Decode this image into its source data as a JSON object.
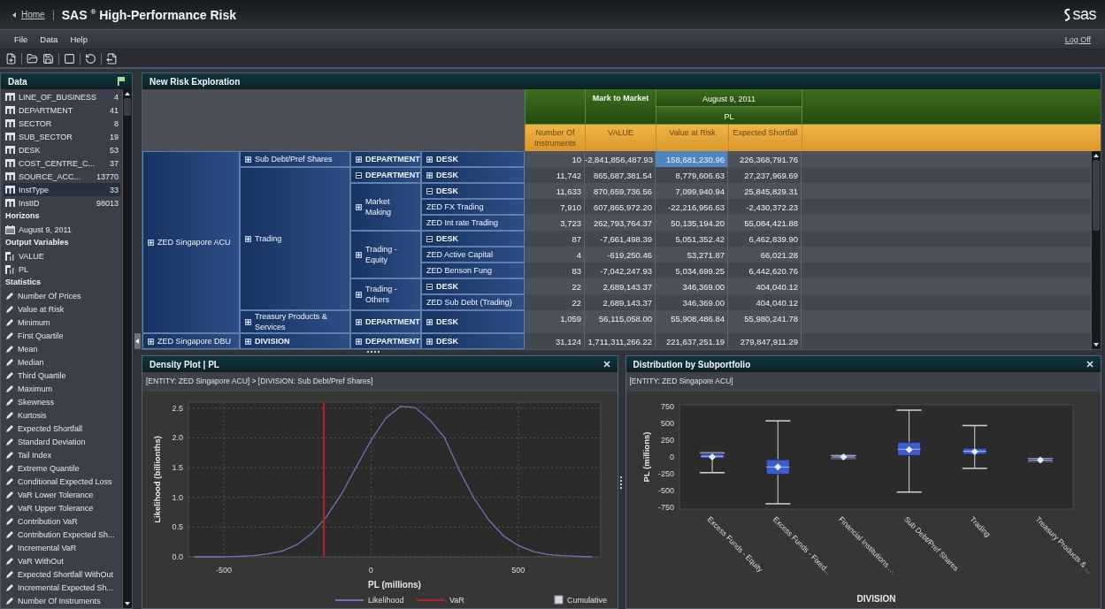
{
  "header": {
    "home_link": "Home",
    "app_title": "SAS $^{®}$ High-Performance Risk",
    "logo_text": "sas"
  },
  "menu": {
    "items": [
      "File",
      "Data",
      "Help"
    ],
    "log_off": "Log Off"
  },
  "data_panel": {
    "title": "Data",
    "groups": [
      {
        "items": [
          {
            "label": "LINE_OF_BUSINESS",
            "count": "4",
            "kind": "dimension",
            "selected": false
          },
          {
            "label": "DEPARTMENT",
            "count": "41",
            "kind": "dimension",
            "selected": false
          },
          {
            "label": "SECTOR",
            "count": "8",
            "kind": "dimension",
            "selected": false
          },
          {
            "label": "SUB_SECTOR",
            "count": "19",
            "kind": "dimension",
            "selected": false
          },
          {
            "label": "DESK",
            "count": "53",
            "kind": "dimension",
            "selected": false
          },
          {
            "label": "COST_CENTRE_C...",
            "count": "37",
            "kind": "dimension",
            "selected": false
          },
          {
            "label": "SOURCE_ACC...",
            "count": "13770",
            "kind": "dimension",
            "selected": false
          },
          {
            "label": "InstType",
            "count": "33",
            "kind": "dimension",
            "selected": true
          },
          {
            "label": "InstID",
            "count": "98013",
            "kind": "dimension",
            "selected": false
          }
        ]
      },
      {
        "heading": "Horizons",
        "items": [
          {
            "label": "August 9, 2011",
            "kind": "date",
            "selected": false
          }
        ]
      },
      {
        "heading": "Output Variables",
        "items": [
          {
            "label": "VALUE",
            "kind": "variable",
            "selected": false
          },
          {
            "label": "PL",
            "kind": "variable",
            "selected": false
          }
        ]
      },
      {
        "heading": "Statistics",
        "items": [
          {
            "label": "Number Of Prices",
            "kind": "statistic",
            "selected": false
          },
          {
            "label": "Value at Risk",
            "kind": "statistic",
            "selected": false
          },
          {
            "label": "Minimum",
            "kind": "statistic",
            "selected": false
          },
          {
            "label": "First Quartile",
            "kind": "statistic",
            "selected": false
          },
          {
            "label": "Mean",
            "kind": "statistic",
            "selected": false
          },
          {
            "label": "Median",
            "kind": "statistic",
            "selected": false
          },
          {
            "label": "Third Quartile",
            "kind": "statistic",
            "selected": false
          },
          {
            "label": "Maximum",
            "kind": "statistic",
            "selected": false
          },
          {
            "label": "Skewness",
            "kind": "statistic",
            "selected": false
          },
          {
            "label": "Kurtosis",
            "kind": "statistic",
            "selected": false
          },
          {
            "label": "Expected Shortfall",
            "kind": "statistic",
            "selected": false
          },
          {
            "label": "Standard Deviation",
            "kind": "statistic",
            "selected": false
          },
          {
            "label": "Tail Index",
            "kind": "statistic",
            "selected": false
          },
          {
            "label": "Extreme Quantile",
            "kind": "statistic",
            "selected": false
          },
          {
            "label": "Conditional Expected Loss",
            "kind": "statistic",
            "selected": false
          },
          {
            "label": "VaR Lower Tolerance",
            "kind": "statistic",
            "selected": false
          },
          {
            "label": "VaR Upper Tolerance",
            "kind": "statistic",
            "selected": false
          },
          {
            "label": "Contribution VaR",
            "kind": "statistic",
            "selected": false
          },
          {
            "label": "Contribution Expected Sh...",
            "kind": "statistic",
            "selected": false
          },
          {
            "label": "Incremental VaR",
            "kind": "statistic",
            "selected": false
          },
          {
            "label": "VaR WithOut",
            "kind": "statistic",
            "selected": false
          },
          {
            "label": "Expected Shortfall WithOut",
            "kind": "statistic",
            "selected": false
          },
          {
            "label": "Incremental Expected Sh...",
            "kind": "statistic",
            "selected": false
          },
          {
            "label": "Number Of Instruments",
            "kind": "statistic",
            "selected": false
          }
        ]
      }
    ]
  },
  "exploration": {
    "title": "New Risk Exploration",
    "column_groups": [
      {
        "label": "Mark to Market"
      },
      {
        "label": "August 9, 2011",
        "sublabel": "PL"
      }
    ],
    "columns": [
      "Number Of Instruments",
      "VALUE",
      "Value at Risk",
      "Expected Shortfall"
    ],
    "rows": [
      {
        "label": "ZED Singapore ACU",
        "kind": "member",
        "expanded": false,
        "children": [
          {
            "label": "Sub Debt/Pref Shares",
            "kind": "member",
            "expanded": false,
            "children": [
              {
                "label": "DEPARTMENT",
                "kind": "level",
                "expanded": false,
                "children": [
                  {
                    "label": "DESK",
                    "kind": "level",
                    "expanded": false,
                    "values": [
                      {
                        "text": "10",
                        "selected": false
                      },
                      {
                        "text": "-2,841,856,487.93",
                        "selected": false
                      },
                      {
                        "text": "158,681,230.96",
                        "selected": true
                      },
                      {
                        "text": "226,368,791.76",
                        "selected": false
                      }
                    ]
                  }
                ]
              }
            ]
          },
          {
            "label": "Trading",
            "kind": "member",
            "expanded": false,
            "children": [
              {
                "label": "DEPARTMENT",
                "kind": "level",
                "expanded": true,
                "children": [
                  {
                    "label": "DESK",
                    "kind": "level",
                    "expanded": false,
                    "values": [
                      {
                        "text": "11,742",
                        "selected": false
                      },
                      {
                        "text": "865,687,381.54",
                        "selected": false
                      },
                      {
                        "text": "8,779,606.63",
                        "selected": false
                      },
                      {
                        "text": "27,237,969.69",
                        "selected": false
                      }
                    ]
                  }
                ]
              },
              {
                "label": "Market Making",
                "kind": "member",
                "expanded": false,
                "children": [
                  {
                    "label": "DESK",
                    "kind": "level",
                    "expanded": true,
                    "values": [
                      {
                        "text": "11,633",
                        "selected": false
                      },
                      {
                        "text": "870,659,736.56",
                        "selected": false
                      },
                      {
                        "text": "7,099,940.94",
                        "selected": false
                      },
                      {
                        "text": "25,845,829.31",
                        "selected": false
                      }
                    ]
                  },
                  {
                    "label": "ZED FX Trading",
                    "kind": "member",
                    "values": [
                      {
                        "text": "7,910",
                        "selected": false
                      },
                      {
                        "text": "607,865,972.20",
                        "selected": false
                      },
                      {
                        "text": "-22,216,956.63",
                        "selected": false
                      },
                      {
                        "text": "-2,430,372.23",
                        "selected": false
                      }
                    ]
                  },
                  {
                    "label": "ZED Int rate Trading",
                    "kind": "member",
                    "values": [
                      {
                        "text": "3,723",
                        "selected": false
                      },
                      {
                        "text": "262,793,764.37",
                        "selected": false
                      },
                      {
                        "text": "50,135,194.20",
                        "selected": false
                      },
                      {
                        "text": "55,084,421.88",
                        "selected": false
                      }
                    ]
                  }
                ]
              },
              {
                "label": "Trading - Equity",
                "kind": "member",
                "expanded": false,
                "children": [
                  {
                    "label": "DESK",
                    "kind": "level",
                    "expanded": true,
                    "values": [
                      {
                        "text": "87",
                        "selected": false
                      },
                      {
                        "text": "-7,661,498.39",
                        "selected": false
                      },
                      {
                        "text": "5,051,352.42",
                        "selected": false
                      },
                      {
                        "text": "6,462,839.90",
                        "selected": false
                      }
                    ]
                  },
                  {
                    "label": "ZED Active Capital",
                    "kind": "member",
                    "values": [
                      {
                        "text": "4",
                        "selected": false
                      },
                      {
                        "text": "-619,250.46",
                        "selected": false
                      },
                      {
                        "text": "53,271.87",
                        "selected": false
                      },
                      {
                        "text": "66,021.28",
                        "selected": false
                      }
                    ]
                  },
                  {
                    "label": "ZED Benson Fung",
                    "kind": "member",
                    "values": [
                      {
                        "text": "83",
                        "selected": false
                      },
                      {
                        "text": "-7,042,247.93",
                        "selected": false
                      },
                      {
                        "text": "5,034,699.25",
                        "selected": false
                      },
                      {
                        "text": "6,442,620.76",
                        "selected": false
                      }
                    ]
                  }
                ]
              },
              {
                "label": "Trading - Others",
                "kind": "member",
                "expanded": false,
                "children": [
                  {
                    "label": "DESK",
                    "kind": "level",
                    "expanded": true,
                    "values": [
                      {
                        "text": "22",
                        "selected": false
                      },
                      {
                        "text": "2,689,143.37",
                        "selected": false
                      },
                      {
                        "text": "346,369.00",
                        "selected": false
                      },
                      {
                        "text": "404,040.12",
                        "selected": false
                      }
                    ]
                  },
                  {
                    "label": "ZED Sub Debt (Trading)",
                    "kind": "member",
                    "values": [
                      {
                        "text": "22",
                        "selected": false
                      },
                      {
                        "text": "2,689,143.37",
                        "selected": false
                      },
                      {
                        "text": "346,369.00",
                        "selected": false
                      },
                      {
                        "text": "404,040.12",
                        "selected": false
                      }
                    ]
                  }
                ]
              }
            ]
          },
          {
            "label": "Treasury Products & Services",
            "kind": "member",
            "expanded": false,
            "children": [
              {
                "label": "DEPARTMENT",
                "kind": "level",
                "expanded": false,
                "children": [
                  {
                    "label": "DESK",
                    "kind": "level",
                    "expanded": false,
                    "values": [
                      {
                        "text": "1,059",
                        "selected": false
                      },
                      {
                        "text": "56,115,058.00",
                        "selected": false
                      },
                      {
                        "text": "55,908,486.84",
                        "selected": false
                      },
                      {
                        "text": "55,980,241.78",
                        "selected": false
                      }
                    ]
                  }
                ]
              }
            ]
          }
        ]
      },
      {
        "label": "ZED Singapore DBU",
        "kind": "member",
        "expanded": false,
        "children": [
          {
            "label": "DIVISION",
            "kind": "level",
            "expanded": false,
            "children": [
              {
                "label": "DEPARTMENT",
                "kind": "level",
                "expanded": false,
                "children": [
                  {
                    "label": "DESK",
                    "kind": "level",
                    "expanded": false,
                    "values": [
                      {
                        "text": "31,124",
                        "selected": false
                      },
                      {
                        "text": "1,711,311,266.22",
                        "selected": false
                      },
                      {
                        "text": "221,637,251.19",
                        "selected": false
                      },
                      {
                        "text": "279,847,911.29",
                        "selected": false
                      }
                    ]
                  }
                ]
              }
            ]
          }
        ]
      }
    ]
  },
  "density_plot": {
    "title": "Density Plot | PL",
    "breadcrumb": "[ENTITY: ZED Singapore ACU] > [DIVISION: Sub Debt/Pref Shares]",
    "chart_data": {
      "type": "line",
      "xlabel": "PL (millions)",
      "ylabel": "Likelihood (billionths)",
      "x": [
        -600,
        -550,
        -500,
        -450,
        -400,
        -350,
        -300,
        -250,
        -200,
        -150,
        -100,
        -50,
        0,
        50,
        100,
        150,
        200,
        250,
        300,
        350,
        400,
        450,
        500,
        550,
        600,
        650,
        700,
        750
      ],
      "series": [
        {
          "name": "Likelihood",
          "color": "#6f74b8",
          "values": [
            0.0,
            0.0,
            0.0,
            0.01,
            0.02,
            0.05,
            0.1,
            0.21,
            0.4,
            0.68,
            1.06,
            1.51,
            1.96,
            2.33,
            2.53,
            2.51,
            2.3,
            2.0,
            1.45,
            0.98,
            0.62,
            0.35,
            0.19,
            0.09,
            0.04,
            0.02,
            0.01,
            0.0
          ]
        }
      ],
      "xlim": [
        -620,
        780
      ],
      "ylim": [
        0,
        2.6
      ],
      "xticks": [
        -500,
        0,
        500
      ],
      "yticks": [
        {
          "value": 0,
          "label": "0.0"
        },
        {
          "value": 0.5,
          "label": "0.5"
        },
        {
          "value": 1,
          "label": "1.0"
        },
        {
          "value": 1.5,
          "label": "1.5"
        },
        {
          "value": 2,
          "label": "2.0"
        },
        {
          "value": 2.5,
          "label": "2.5"
        }
      ],
      "grid": true,
      "legend": true,
      "ref_lines": [
        {
          "axis": "x",
          "value": -160,
          "label": "VaR",
          "color": "#b3202a"
        }
      ]
    },
    "cumulative": {
      "label": "Cumulative",
      "checked": false
    }
  },
  "distribution": {
    "title": "Distribution by Subportfolio",
    "breadcrumb": "[ENTITY: ZED Singapore ACU]",
    "box_plot": {
      "kind": "box",
      "xlabel": "DIVISION",
      "ylabel": "PL (millions)",
      "categories": [
        "Excess Funds - Equity",
        "Excess Funds - Fixed...",
        "Financial Institutions ...",
        "Sub Debt/Pref Shares",
        "Trading",
        "Treasury Products & ..."
      ],
      "ytick_labels": [
        "750",
        "500",
        "250",
        "0",
        "-250",
        "-500",
        "-750"
      ]
    }
  }
}
